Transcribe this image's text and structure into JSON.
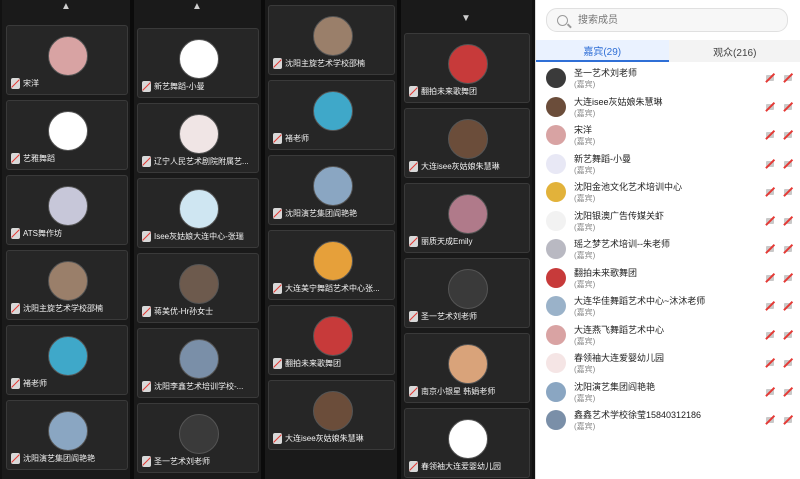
{
  "columns": [
    {
      "arrow": "up",
      "tiles": [
        {
          "name": "宋洋",
          "avatar_color": "#d8a3a3"
        },
        {
          "name": "艺雅舞蹈",
          "avatar_color": "#ffffff"
        },
        {
          "name": "ATS舞作坊",
          "avatar_color": "#c7c7d9"
        },
        {
          "name": "沈阳主旋艺术学校邵楠",
          "avatar_color": "#9a7f6a"
        },
        {
          "name": "褚老师",
          "avatar_color": "#3fa8c9"
        },
        {
          "name": "沈阳演艺集团阎艳艳",
          "avatar_color": "#8aa6c2"
        }
      ]
    },
    {
      "arrow": "up",
      "tiles": [
        {
          "name": "新艺舞蹈-小曼",
          "avatar_color": "#ffffff"
        },
        {
          "name": "辽宁人民艺术剧院附属艺...",
          "avatar_color": "#f0e5e5"
        },
        {
          "name": "Isee灰姑娘大连中心-张瑞",
          "avatar_color": "#cfe6f2"
        },
        {
          "name": "蒋美优-Hr孙女士",
          "avatar_color": "#6d5a4d"
        },
        {
          "name": "沈阳李鑫艺术培训学校-...",
          "avatar_color": "#7a8fa8"
        },
        {
          "name": "圣一艺术刘老师",
          "avatar_color": "#3a3a3a"
        }
      ]
    },
    {
      "arrow": "none",
      "tiles": [
        {
          "name": "沈阳主旋艺术学校邵楠",
          "avatar_color": "#9a7f6a"
        },
        {
          "name": "褚老师",
          "avatar_color": "#3fa8c9"
        },
        {
          "name": "沈阳演艺集团阎艳艳",
          "avatar_color": "#8aa6c2"
        },
        {
          "name": "大连美宁舞蹈艺术中心张...",
          "avatar_color": "#e6a03a"
        },
        {
          "name": "翻拍未来歌舞团",
          "avatar_color": "#c73a3a"
        },
        {
          "name": "大连isee灰姑娘朱慧琳",
          "avatar_color": "#6b4d3a"
        }
      ]
    },
    {
      "arrow": "down",
      "tiles": [
        {
          "name": "翻拍未来歌舞团",
          "avatar_color": "#c73a3a"
        },
        {
          "name": "大连isee灰姑娘朱慧琳",
          "avatar_color": "#6b4d3a"
        },
        {
          "name": "丽质天成Emily",
          "avatar_color": "#b07a8a"
        },
        {
          "name": "圣一艺术刘老师",
          "avatar_color": "#3a3a3a"
        },
        {
          "name": "南京小银星 韩娟老师",
          "avatar_color": "#d9a37a"
        },
        {
          "name": "春领袖大连爱婴幼儿园",
          "avatar_color": "#ffffff"
        }
      ]
    }
  ],
  "panel": {
    "search_placeholder": "搜索成员",
    "tabs": [
      {
        "label": "嘉宾(29)",
        "active": true
      },
      {
        "label": "观众(216)",
        "active": false
      }
    ],
    "members": [
      {
        "name": "圣一艺术刘老师",
        "role": "(嘉宾)",
        "avatar_color": "#3a3a3a"
      },
      {
        "name": "大连isee灰姑娘朱慧琳",
        "role": "(嘉宾)",
        "avatar_color": "#6b4d3a"
      },
      {
        "name": "宋洋",
        "role": "(嘉宾)",
        "avatar_color": "#d8a3a3"
      },
      {
        "name": "新艺舞蹈-小曼",
        "role": "(嘉宾)",
        "avatar_color": "#e8e8f5"
      },
      {
        "name": "沈阳金池文化艺术培训中心",
        "role": "(嘉宾)",
        "avatar_color": "#e2b23a"
      },
      {
        "name": "沈阳银澳广告传媒关虾",
        "role": "(嘉宾)",
        "avatar_color": "#f2f2f2"
      },
      {
        "name": "瑶之梦艺术培训--朱老师",
        "role": "(嘉宾)",
        "avatar_color": "#b9b9c2"
      },
      {
        "name": "翻拍未来歌舞团",
        "role": "(嘉宾)",
        "avatar_color": "#c73a3a"
      },
      {
        "name": "大连华佳舞蹈艺术中心~沐沐老师",
        "role": "(嘉宾)",
        "avatar_color": "#9ab2c9"
      },
      {
        "name": "大连燕飞舞蹈艺术中心",
        "role": "(嘉宾)",
        "avatar_color": "#d9a3a3"
      },
      {
        "name": "春领袖大连爱婴幼儿园",
        "role": "(嘉宾)",
        "avatar_color": "#f5e5e5"
      },
      {
        "name": "沈阳演艺集团阎艳艳",
        "role": "(嘉宾)",
        "avatar_color": "#8aa6c2"
      },
      {
        "name": "鑫鑫艺术学校徐莹15840312186",
        "role": "(嘉宾)",
        "avatar_color": "#7a8fa8"
      }
    ]
  }
}
